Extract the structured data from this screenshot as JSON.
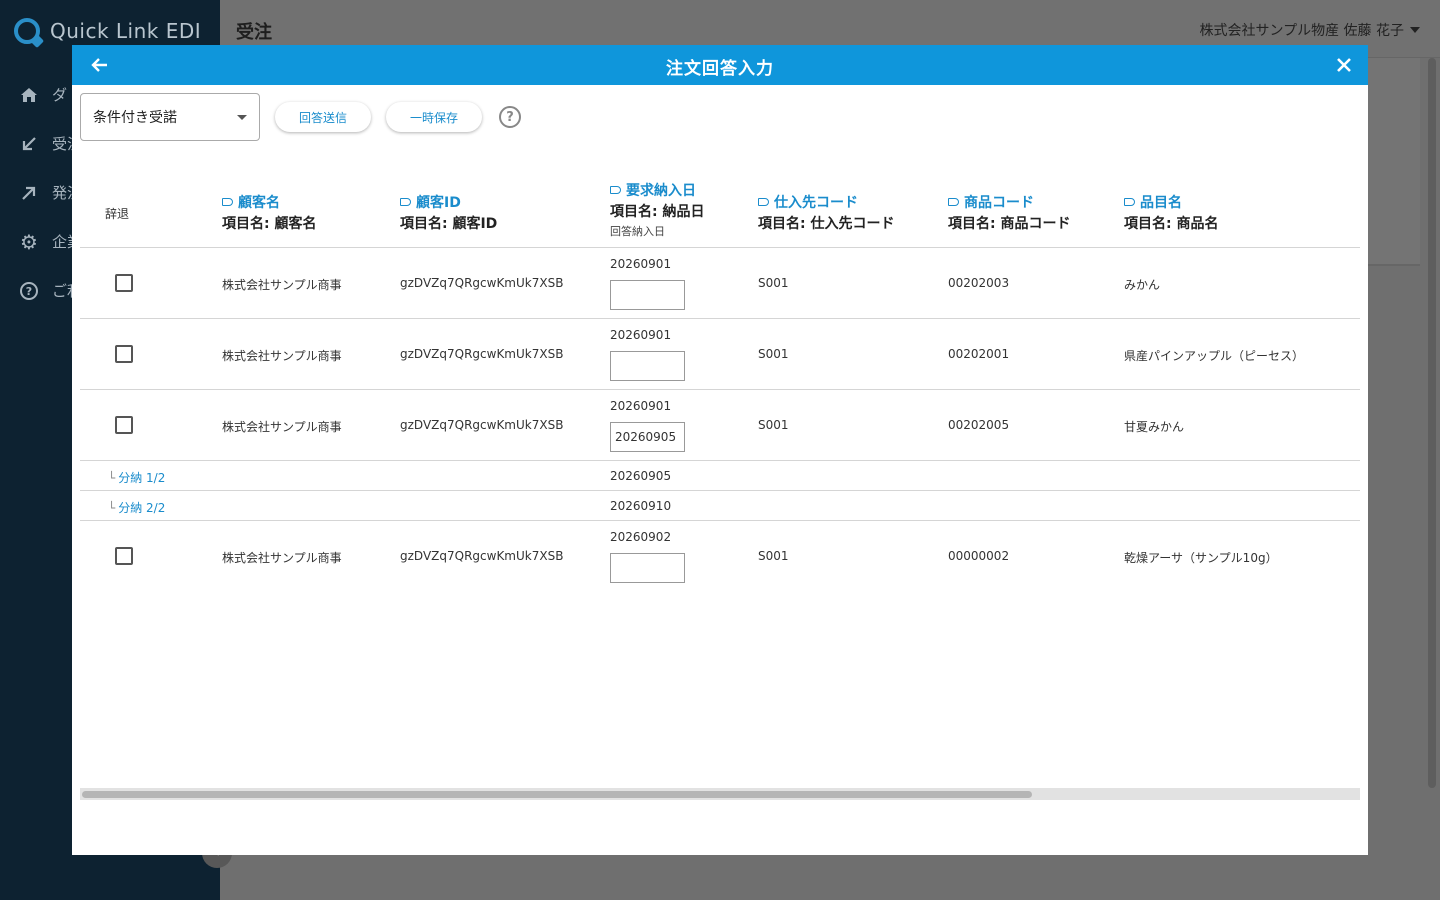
{
  "app": {
    "logo_text": "Quick Link EDI",
    "page_title": "受注",
    "user_label": "株式会社サンプル物産 佐藤 花子"
  },
  "sidebar": {
    "items": [
      {
        "label": "ダ",
        "icon": "home-icon"
      },
      {
        "label": "受注",
        "icon": "arrow-in-icon"
      },
      {
        "label": "発注",
        "icon": "arrow-out-icon"
      },
      {
        "label": "企業",
        "icon": "gear-icon"
      },
      {
        "label": "ご利",
        "icon": "help-circle-icon"
      }
    ]
  },
  "modal": {
    "title": "注文回答入力",
    "response_select": "条件付き受諾",
    "send_button": "回答送信",
    "save_button": "一時保存",
    "help": "?"
  },
  "columns": {
    "decline": "辞退",
    "customer_name": {
      "link": "顧客名",
      "sub": "項目名: 顧客名"
    },
    "customer_id": {
      "link": "顧客ID",
      "sub": "項目名: 顧客ID"
    },
    "delivery_date": {
      "link": "要求納入日",
      "sub": "項目名: 納品日",
      "small": "回答納入日"
    },
    "supplier_code": {
      "link": "仕入先コード",
      "sub": "項目名: 仕入先コード"
    },
    "product_code": {
      "link": "商品コード",
      "sub": "項目名: 商品コード"
    },
    "item_name": {
      "link": "品目名",
      "sub": "項目名: 商品名"
    }
  },
  "rows": [
    {
      "customer": "株式会社サンプル商事",
      "customer_id": "gzDVZq7QRgcwKmUk7XSB",
      "req_date": "20260901",
      "answer_date": "",
      "supplier": "S001",
      "product_code": "00202003",
      "item": "みかん"
    },
    {
      "customer": "株式会社サンプル商事",
      "customer_id": "gzDVZq7QRgcwKmUk7XSB",
      "req_date": "20260901",
      "answer_date": "",
      "supplier": "S001",
      "product_code": "00202001",
      "item": "県産パインアップル（ピーセス）"
    },
    {
      "customer": "株式会社サンプル商事",
      "customer_id": "gzDVZq7QRgcwKmUk7XSB",
      "req_date": "20260901",
      "answer_date": "20260905",
      "supplier": "S001",
      "product_code": "00202005",
      "item": "甘夏みかん"
    },
    {
      "customer": "株式会社サンプル商事",
      "customer_id": "gzDVZq7QRgcwKmUk7XSB",
      "req_date": "20260902",
      "answer_date": "",
      "supplier": "S001",
      "product_code": "00000002",
      "item": "乾燥アーサ（サンプル10g）"
    }
  ],
  "splits": [
    {
      "branch": "└",
      "label": "分納 1/2",
      "date": "20260905"
    },
    {
      "branch": "└",
      "label": "分納 2/2",
      "date": "20260910"
    }
  ],
  "colors": {
    "header_blue": "#0f96db",
    "link_blue": "#1a8ccc",
    "sidebar_bg": "#0d2231"
  }
}
